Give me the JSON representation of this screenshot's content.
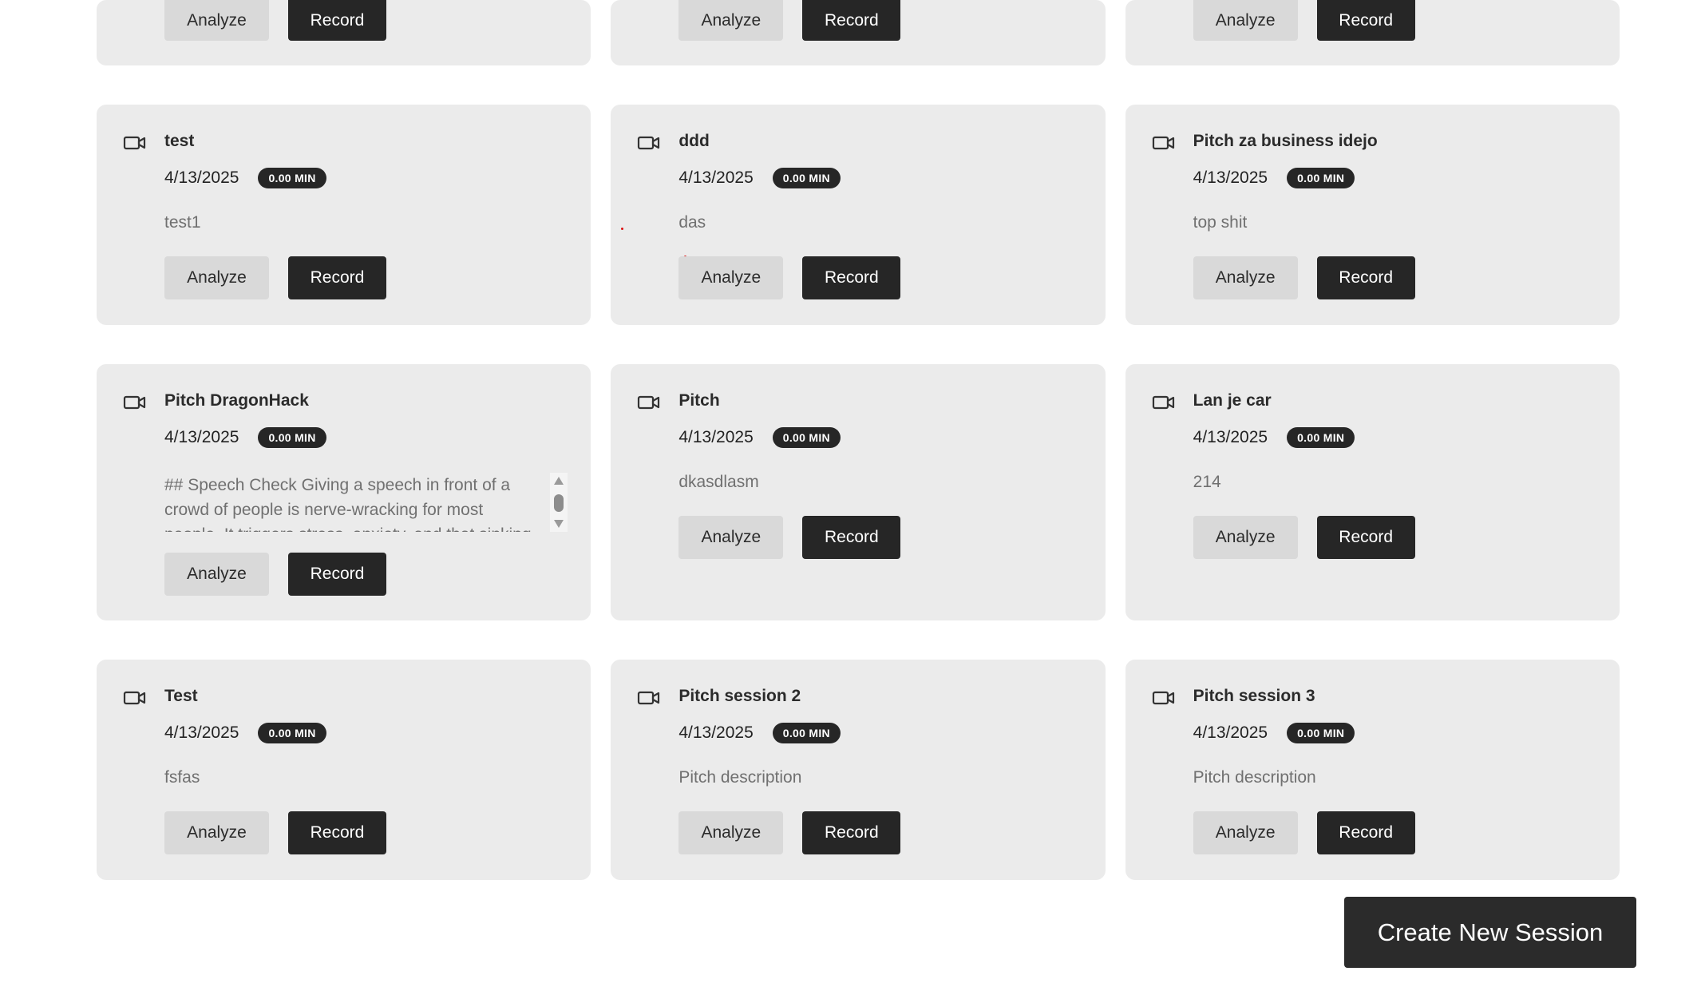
{
  "buttons": {
    "analyze": "Analyze",
    "record": "Record",
    "create": "Create New Session"
  },
  "top_row": [
    {
      "id": "top-1"
    },
    {
      "id": "top-2"
    },
    {
      "id": "top-3"
    }
  ],
  "sessions": [
    {
      "title": "test",
      "date": "4/13/2025",
      "duration": "0.00 MIN",
      "description": "test1"
    },
    {
      "title": "ddd",
      "date": "4/13/2025",
      "duration": "0.00 MIN",
      "description": "das"
    },
    {
      "title": "Pitch za business idejo",
      "date": "4/13/2025",
      "duration": "0.00 MIN",
      "description": "top shit"
    },
    {
      "title": "Pitch DragonHack",
      "date": "4/13/2025",
      "duration": "0.00 MIN",
      "description": "## Speech Check Giving a speech in front of a crowd of people is nerve-wracking for most people. It triggers stress, anxiety, and that sinking"
    },
    {
      "title": "Pitch",
      "date": "4/13/2025",
      "duration": "0.00 MIN",
      "description": "dkasdlasm"
    },
    {
      "title": "Lan je car",
      "date": "4/13/2025",
      "duration": "0.00 MIN",
      "description": "214"
    },
    {
      "title": "Test",
      "date": "4/13/2025",
      "duration": "0.00 MIN",
      "description": "fsfas"
    },
    {
      "title": "Pitch session 2",
      "date": "4/13/2025",
      "duration": "0.00 MIN",
      "description": "Pitch description"
    },
    {
      "title": "Pitch session 3",
      "date": "4/13/2025",
      "duration": "0.00 MIN",
      "description": "Pitch description"
    }
  ],
  "icons": {
    "session": "video-camera-icon",
    "scroll_up": "scroll-up-arrow-icon",
    "scroll_down": "scroll-down-arrow-icon"
  },
  "colors": {
    "card_bg": "#ebebeb",
    "record_bg": "#262626",
    "analyze_bg": "#d9d9d9",
    "badge_bg": "#262626"
  }
}
